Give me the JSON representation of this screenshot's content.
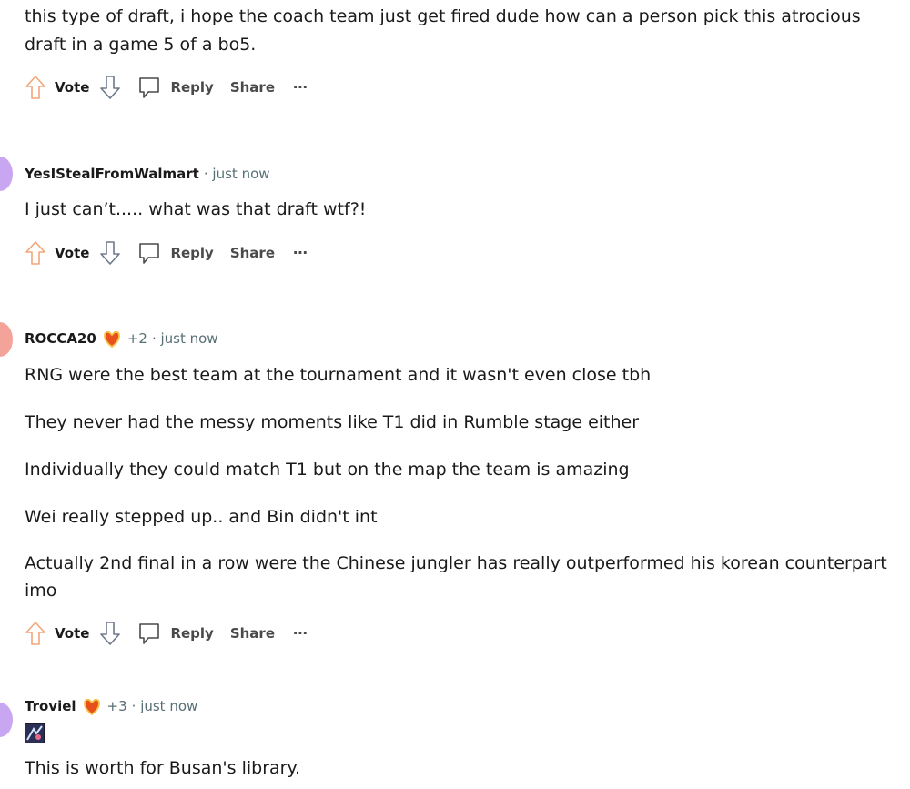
{
  "comments": [
    {
      "body": [
        "this type of draft, i hope the coach team just get fired dude how can a person pick this atrocious",
        "draft in a game 5 of a bo5."
      ],
      "actions": {
        "vote": "Vote",
        "reply": "Reply",
        "share": "Share",
        "more": "⋯"
      }
    },
    {
      "author": "YesIStealFromWalmart",
      "time": "· just now",
      "body": [
        "I just can’t..... what was that draft wtf?!"
      ],
      "actions": {
        "vote": "Vote",
        "reply": "Reply",
        "share": "Share",
        "more": "⋯"
      }
    },
    {
      "author": "ROCCA20",
      "flair_count": "+2",
      "time": "· just now",
      "body": [
        "RNG were the best team at the tournament and it wasn't even close tbh",
        "They never had the messy moments like T1 did in Rumble stage either",
        "Individually they could match T1 but on the map the team is amazing",
        "Wei really stepped up.. and Bin didn't int",
        "Actually 2nd final in a row were the Chinese jungler has really outperformed his korean counterpart",
        "imo"
      ],
      "actions": {
        "vote": "Vote",
        "reply": "Reply",
        "share": "Share",
        "more": "⋯"
      }
    },
    {
      "author": "Troviel",
      "flair_count": "+3",
      "time": "· just now",
      "body": [
        "This is worth for Busan's library."
      ]
    }
  ],
  "colors": {
    "avatar_purple": "#c9a6f2",
    "avatar_red": "#f4a39a",
    "meta_gray": "#576f76"
  },
  "icons": [
    "upvote-icon",
    "downvote-icon",
    "reply-icon",
    "more-icon",
    "flair-icon",
    "avatar",
    "emote-image"
  ]
}
